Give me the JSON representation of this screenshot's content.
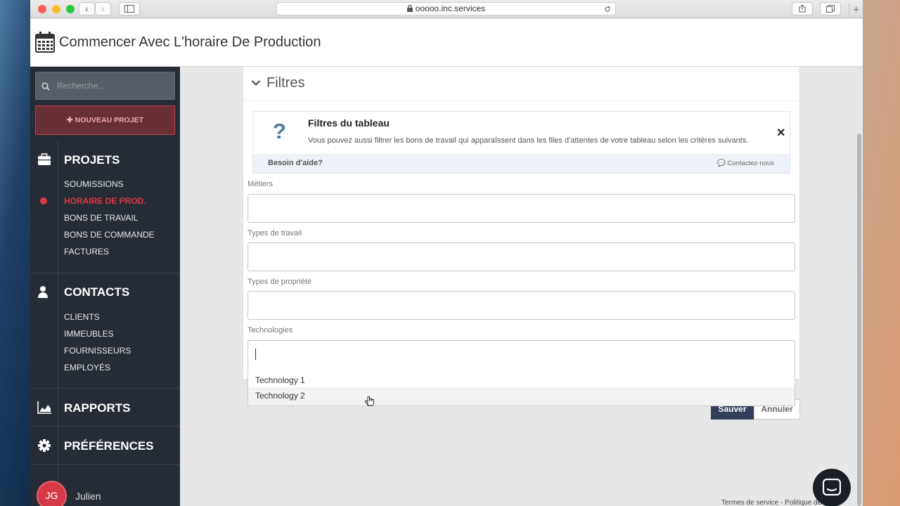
{
  "browser": {
    "url": "ooooo.inc.services"
  },
  "app": {
    "title": "Commencer Avec L'horaire De Production"
  },
  "sidebar": {
    "search_placeholder": "Recherche...",
    "new_project": "NOUVEAU PROJET",
    "projets": {
      "heading": "PROJETS",
      "items": [
        "SOUMISSIONS",
        "HORAIRE DE PROD.",
        "BONS DE TRAVAIL",
        "BONS DE COMMANDE",
        "FACTURES"
      ]
    },
    "contacts": {
      "heading": "CONTACTS",
      "items": [
        "CLIENTS",
        "IMMEUBLES",
        "FOURNISSEURS",
        "EMPLOYÉS"
      ]
    },
    "rapports": "RAPPORTS",
    "preferences": "PRÉFÉRENCES",
    "user": {
      "initials": "JG",
      "name": "Julien"
    }
  },
  "filters": {
    "title": "Filtres",
    "info": {
      "title": "Filtres du tableau",
      "text": "Vous pouvez aussi filtrer les bons de travail qui apparaîssent dans les files d'attentes de votre tableau selon les critères suivants.",
      "help": "Besoin d'aide?",
      "contact": "Contactez-nous"
    },
    "labels": {
      "metiers": "Métiers",
      "types_travail": "Types de travail",
      "types_propriete": "Types de propriété",
      "technologies": "Technologies"
    },
    "options": [
      "Technology 1",
      "Technology 2"
    ],
    "save": "Sauver",
    "cancel": "Annuler"
  },
  "footer": "Termes de service - Politique de confidentialité",
  "colors": {
    "active": "#d63a46",
    "sidebar": "#262c36",
    "save": "#34405a"
  }
}
